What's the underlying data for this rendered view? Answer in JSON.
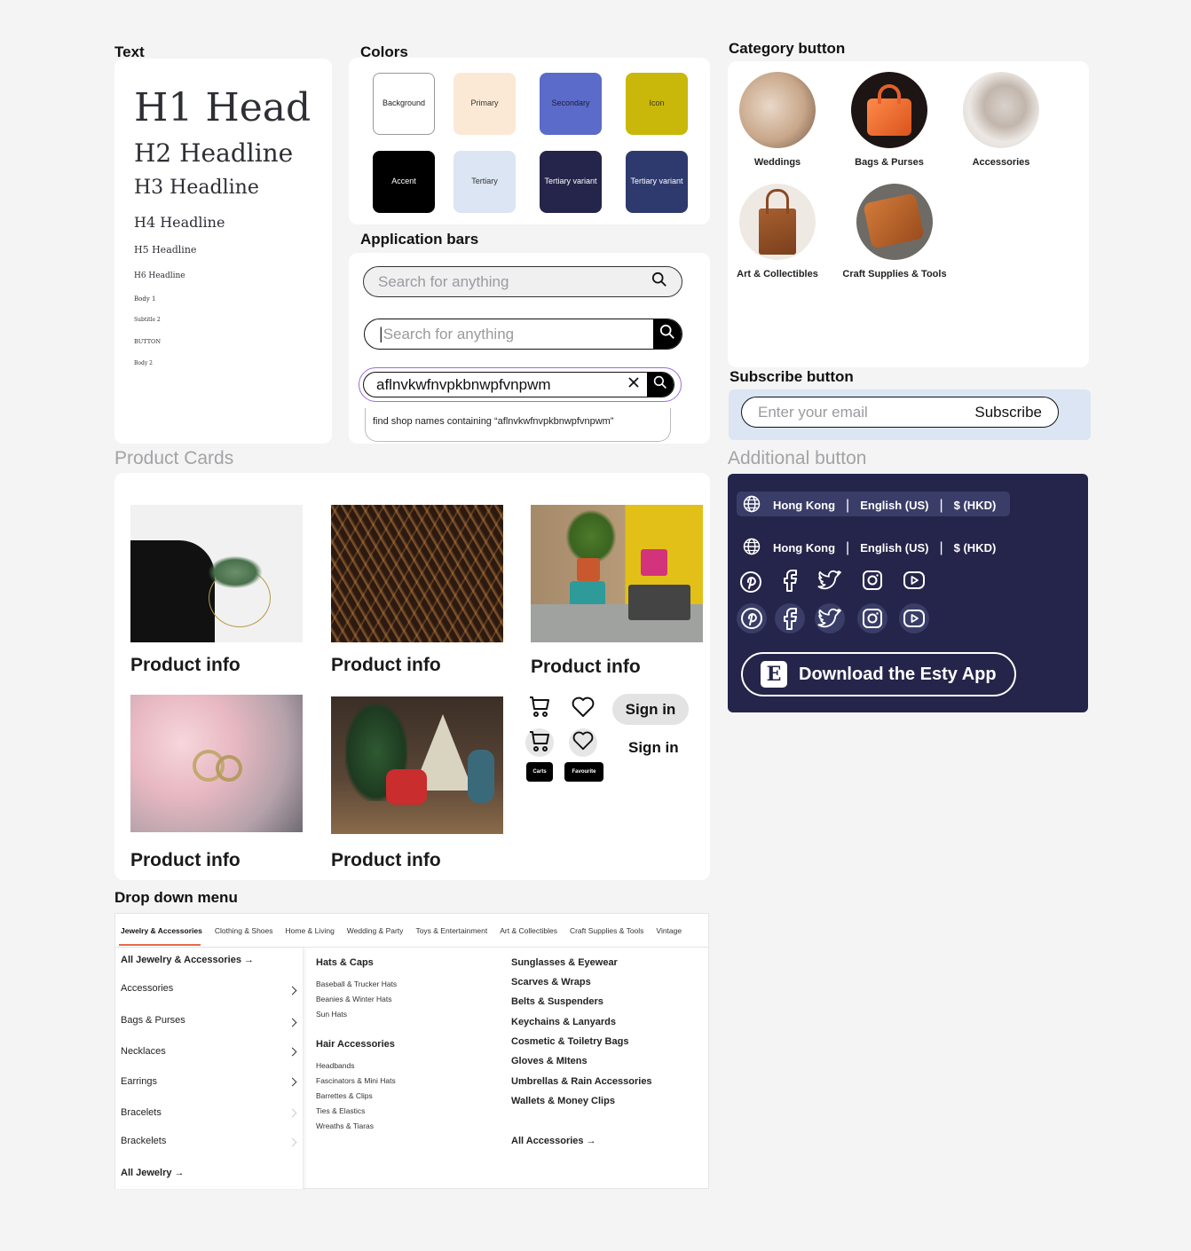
{
  "sections": {
    "text": "Text",
    "colors": "Colors",
    "category": "Category button",
    "appbars": "Application bars",
    "subscribe": "Subscribe button",
    "product_cards": "Product Cards",
    "additional": "Additional button",
    "dropdown": "Drop down menu"
  },
  "typography": {
    "h1": "H1 Head",
    "h2": "H2 Headline",
    "h3": "H3 Headline",
    "h4": "H4 Headline",
    "h5": "H5 Headline",
    "h6": "H6 Headline",
    "body1": "Body 1",
    "subtitle2": "Subtitle 2",
    "button": "BUTTON",
    "body2": "Body 2"
  },
  "colors": {
    "background": {
      "label": "Background",
      "hex": "#ffffff"
    },
    "primary": {
      "label": "Primary",
      "hex": "#fce9d5"
    },
    "secondary": {
      "label": "Secondary",
      "hex": "#5b6bc9"
    },
    "icon": {
      "label": "Icon",
      "hex": "#c9b70a"
    },
    "accent": {
      "label": "Accent",
      "hex": "#000000"
    },
    "tertiary": {
      "label": "Tertiary",
      "hex": "#dbe5f3"
    },
    "tertiary_variant_1": {
      "label": "Tertiary variant",
      "hex": "#25244a"
    },
    "tertiary_variant_2": {
      "label": "Tertiary variant",
      "hex": "#2e3a6e"
    }
  },
  "search": {
    "placeholder1": "Search for anything",
    "placeholder2": "Search for anything",
    "cursor_bar": "|",
    "query": "aflnvkwfnvpkbnwpfvnpwm",
    "suggestion": "find shop names containing “aflnvkwfnvpkbnwpfvnpwm”"
  },
  "categories": [
    {
      "label": "Weddings",
      "icon": "necklace-photo"
    },
    {
      "label": "Bags & Purses",
      "icon": "orange-bag-photo"
    },
    {
      "label": "Accessories",
      "icon": "button-photo"
    },
    {
      "label": "Art & Collectibles",
      "icon": "tote-bag-photo"
    },
    {
      "label": "Craft Supplies & Tools",
      "icon": "wallet-photo"
    }
  ],
  "subscribe": {
    "placeholder": "Enter your email",
    "button": "Subscribe"
  },
  "products": [
    {
      "title": "Product info"
    },
    {
      "title": "Product info"
    },
    {
      "title": "Product info"
    },
    {
      "title": "Product info"
    },
    {
      "title": "Product info"
    }
  ],
  "product_actions": {
    "sign_in_filled": "Sign in",
    "sign_in_plain": "Sign in",
    "tooltip_cart": "Carts",
    "tooltip_fav": "Favourite"
  },
  "locale": {
    "region": "Hong Kong",
    "language": "English (US)",
    "currency": "$ (HKD)",
    "sep": "|"
  },
  "social_icons": [
    "pinterest-icon",
    "facebook-icon",
    "twitter-icon",
    "instagram-icon",
    "youtube-icon"
  ],
  "download": {
    "label": "Download the Esty App",
    "logo": "E"
  },
  "dropdown": {
    "tabs": [
      "Jewelry & Accessories",
      "Clothing & Shoes",
      "Home & Living",
      "Wedding & Party",
      "Toys  & Entertainment",
      "Art & Collectibles",
      "Craft Supplies & Tools",
      "Vintage"
    ],
    "left_header": "All Jewelry & Accessories",
    "left_items": [
      "Accessories",
      "Bags & Purses",
      "Necklaces",
      "Earrings",
      "Bracelets",
      "Brackelets"
    ],
    "left_footer": "All Jewelry",
    "mid_group1_title": "Hats & Caps",
    "mid_group1": [
      "Baseball &  Trucker Hats",
      "Beanies  &  Winter Hats",
      "Sun Hats"
    ],
    "mid_group2_title": "Hair Accessories",
    "mid_group2": [
      "Headbands",
      "Fascinators & Mini Hats",
      "Barrettes & Clips",
      "Ties & Elastics",
      "Wreaths & Tiaras"
    ],
    "right_items": [
      "Sunglasses & Eyewear",
      "Scarves & Wraps",
      "Belts & Suspenders",
      "Keychains & Lanyards",
      "Cosmetic & Toiletry Bags",
      "Gloves & MItens",
      "Umbrellas & Rain Accessories",
      "Wallets & Money Clips"
    ],
    "right_footer": "All Accessories"
  }
}
